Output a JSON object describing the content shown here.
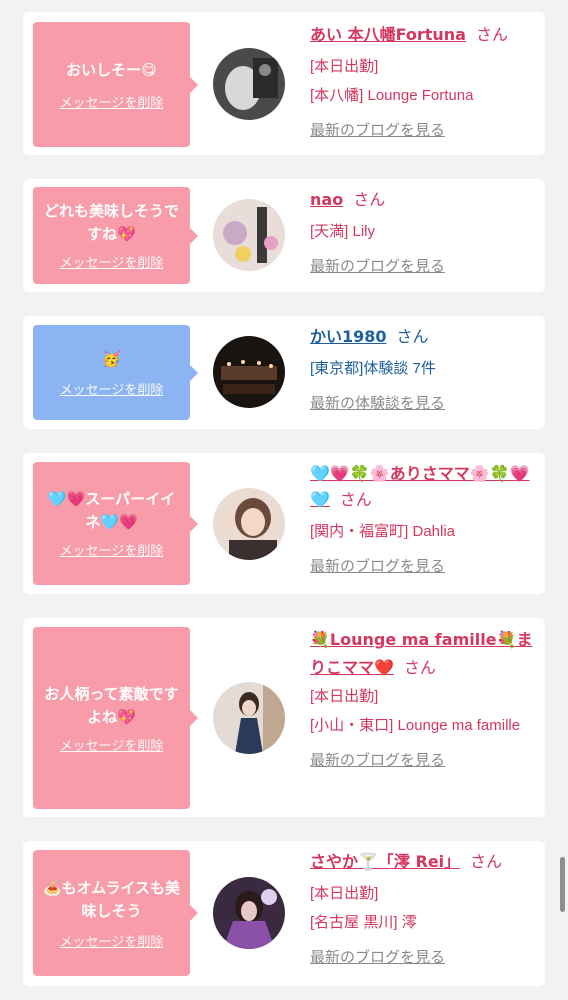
{
  "items": [
    {
      "message": "おいしそー😋",
      "delete_label": "メッセージを削除",
      "name": "あい 本八幡Fortuna",
      "honorific": "さん",
      "details": [
        "[本日出勤]",
        "[本八幡] Lounge Fortuna"
      ],
      "more_label": "最新のブログを見る",
      "theme": "pink"
    },
    {
      "message": "どれも美味しそうですね💖",
      "delete_label": "メッセージを削除",
      "name": "nao",
      "honorific": "さん",
      "details": [
        "[天満] Lily"
      ],
      "more_label": "最新のブログを見る",
      "theme": "pink"
    },
    {
      "message": "🥳",
      "delete_label": "メッセージを削除",
      "name": "かい1980",
      "honorific": "さん",
      "details": [
        "[東京都]体験談 7件"
      ],
      "more_label": "最新の体験談を見る",
      "theme": "blue"
    },
    {
      "message": "🩵💗スーパーイイネ🩵💗",
      "delete_label": "メッセージを削除",
      "name": "🩵💗🍀🌸ありさママ🌸🍀💗🩵",
      "honorific": "さん",
      "details": [
        "[関内・福富町] Dahlia"
      ],
      "more_label": "最新のブログを見る",
      "theme": "pink"
    },
    {
      "message": "お人柄って素敵ですよね💖",
      "delete_label": "メッセージを削除",
      "name": "💐Lounge ma famille💐まりこママ❤️",
      "honorific": "さん",
      "details": [
        "[本日出勤]",
        "[小山・東口] Lounge ma famille"
      ],
      "more_label": "最新のブログを見る",
      "theme": "pink"
    },
    {
      "message": "🍝もオムライスも美味しそう",
      "delete_label": "メッセージを削除",
      "name": "さやか🍸「澪 Rei」",
      "honorific": "さん",
      "details": [
        "[本日出勤]",
        "[名古屋 黒川] 澪"
      ],
      "more_label": "最新のブログを見る",
      "theme": "pink"
    }
  ],
  "colors": {
    "pink_bubble": "#f89ca9",
    "blue_bubble": "#8cb4f2",
    "pink_text": "#d6375f",
    "blue_text": "#1f5f9e",
    "link_gray": "#8a8a8a"
  }
}
